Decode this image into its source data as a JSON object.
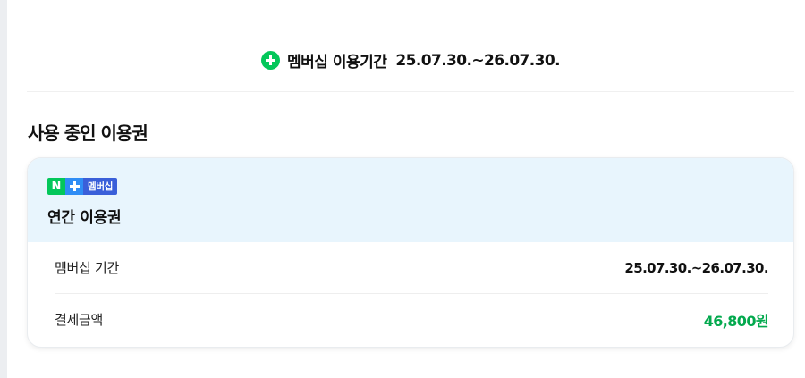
{
  "banner": {
    "icon": "plus-circle-icon",
    "label": "멤버십 이용기간",
    "value": "25.07.30.~26.07.30."
  },
  "section": {
    "title": "사용 중인 이용권"
  },
  "pass": {
    "badge": {
      "n": "N",
      "plus_icon": "plus-icon",
      "text": "멤버십"
    },
    "name": "연간 이용권",
    "rows": [
      {
        "label": "멤버십 기간",
        "value": "25.07.30.~26.07.30."
      },
      {
        "label": "결제금액",
        "value": "46,800원"
      }
    ]
  },
  "colors": {
    "brand_green": "#03c75a",
    "amount_green": "#03a94e",
    "card_header_bg": "#e8f5fd",
    "badge_blue": "#2f8df5",
    "badge_indigo": "#3a5fd9"
  }
}
